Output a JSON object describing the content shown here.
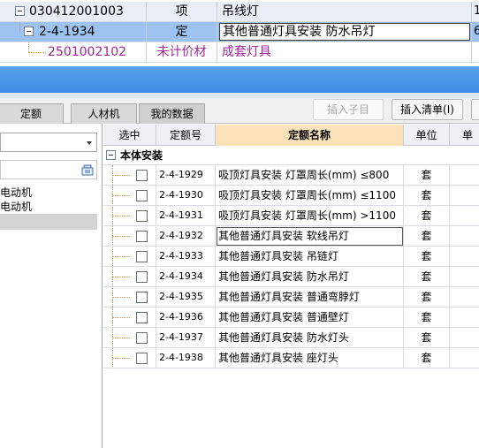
{
  "top_grid": {
    "rows": [
      {
        "code": "030412001003",
        "type": "项",
        "name": "吊线灯",
        "extra": "1"
      },
      {
        "code": "2-4-1934",
        "type": "定",
        "name": "其他普通灯具安装  防水吊灯",
        "extra": "6"
      },
      {
        "code": "2501002102",
        "type": "未计价材",
        "name": "成套灯具",
        "extra": ""
      }
    ]
  },
  "tabs": [
    "定额",
    "人材机",
    "我的数据"
  ],
  "toolbar": {
    "insert_child_label": "插入子目",
    "insert_list_label": "插入清单(I)"
  },
  "left_panel": {
    "dropdown_value": "",
    "search_placeholder": "",
    "items": [
      "流电动机",
      "步电动机",
      ""
    ]
  },
  "table": {
    "headers": {
      "select": "选中",
      "code": "定额号",
      "name": "定额名称",
      "unit": "单位",
      "extra": "单"
    },
    "group_label": "本体安装",
    "rows": [
      {
        "code": "2-4-1929",
        "name": "吸顶灯具安装 灯罩周长(mm) ≤800",
        "unit": "套"
      },
      {
        "code": "2-4-1930",
        "name": "吸顶灯具安装 灯罩周长(mm) ≤1100",
        "unit": "套"
      },
      {
        "code": "2-4-1931",
        "name": "吸顶灯具安装 灯罩周长(mm) >1100",
        "unit": "套"
      },
      {
        "code": "2-4-1932",
        "name": "其他普通灯具安装 软线吊灯",
        "unit": "套"
      },
      {
        "code": "2-4-1933",
        "name": "其他普通灯具安装 吊链灯",
        "unit": "套"
      },
      {
        "code": "2-4-1934",
        "name": "其他普通灯具安装 防水吊灯",
        "unit": "套"
      },
      {
        "code": "2-4-1935",
        "name": "其他普通灯具安装 普通弯脖灯",
        "unit": "套"
      },
      {
        "code": "2-4-1936",
        "name": "其他普通灯具安装 普通壁灯",
        "unit": "套"
      },
      {
        "code": "2-4-1937",
        "name": "其他普通灯具安装 防水灯头",
        "unit": "套"
      },
      {
        "code": "2-4-1938",
        "name": "其他普通灯具安装 座灯头",
        "unit": "套"
      }
    ]
  },
  "colors": {
    "selected_row": "#9cc3f1",
    "header_row": "#e9eef6",
    "unpriced_text": "#a0249a",
    "active_header": "#fbe2b8",
    "blue_band": "#3b8ee5"
  },
  "icons": {
    "expander": "minus-box-icon",
    "search": "search-icon",
    "dropdown": "chevron-down-icon"
  }
}
